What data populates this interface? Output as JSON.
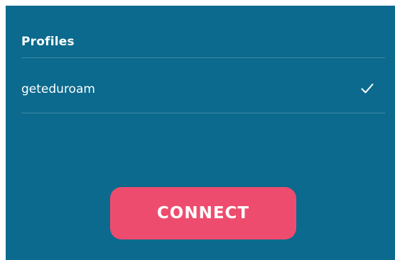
{
  "profiles": {
    "header": "Profiles",
    "items": [
      {
        "name": "geteduroam",
        "selected": true,
        "indicator_icon": "check-icon"
      }
    ]
  },
  "actions": {
    "connect_label": "CONNECT"
  },
  "colors": {
    "panel_background": "#0b6a8d",
    "button_background": "#ee4c6e",
    "text": "#ffffff"
  }
}
